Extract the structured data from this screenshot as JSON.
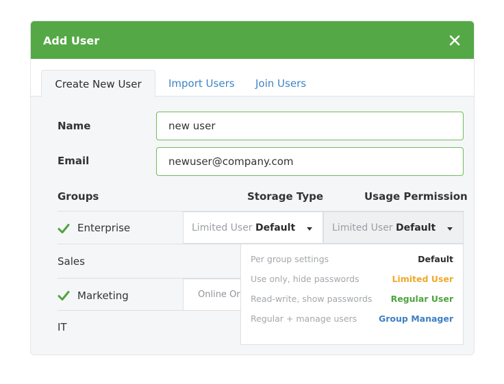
{
  "dialog": {
    "title": "Add User",
    "tabs": [
      {
        "label": "Create New User"
      },
      {
        "label": "Import Users"
      },
      {
        "label": "Join Users"
      }
    ]
  },
  "form": {
    "name_label": "Name",
    "name_value": "new user",
    "email_label": "Email",
    "email_value": "newuser@company.com"
  },
  "table": {
    "headers": {
      "groups": "Groups",
      "storage": "Storage Type",
      "usage": "Usage Permission"
    },
    "rows": [
      {
        "name": "Enterprise",
        "checked": true,
        "storage_muted": "Limited User",
        "storage_value": "Default",
        "usage_muted": "Limited User",
        "usage_value": "Default"
      },
      {
        "name": "Sales",
        "checked": false
      },
      {
        "name": "Marketing",
        "checked": true,
        "storage_muted": "Online Or"
      },
      {
        "name": "IT",
        "checked": false
      }
    ]
  },
  "permission_menu": {
    "options": [
      {
        "desc": "Per group settings",
        "value": "Default",
        "color": "#2b2b2b"
      },
      {
        "desc": "Use only, hide passwords",
        "value": "Limited User",
        "color": "#f0a82b"
      },
      {
        "desc": "Read-write, show passwords",
        "value": "Regular User",
        "color": "#4ea33f"
      },
      {
        "desc": "Regular + manage users",
        "value": "Group Manager",
        "color": "#3d7fc4"
      }
    ]
  },
  "colors": {
    "accent": "#55a846",
    "link": "#3d84c6",
    "input_border": "#6cbd5c"
  },
  "icons": {
    "close": "close-icon",
    "check": "checkmark-icon",
    "caret": "chevron-down-icon"
  }
}
